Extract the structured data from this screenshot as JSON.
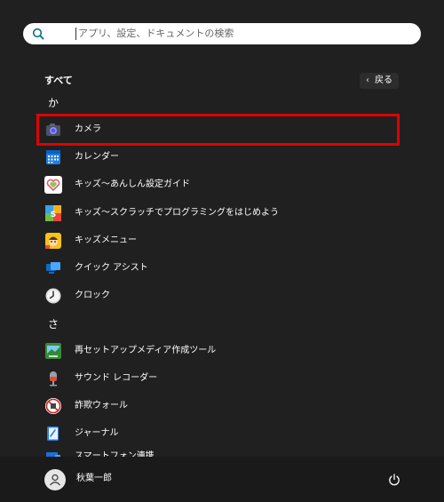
{
  "search": {
    "placeholder": "アプリ、設定、ドキュメントの検索"
  },
  "header": {
    "all_label": "すべて",
    "back_label": "戻る"
  },
  "sections": [
    {
      "letter": "か"
    },
    {
      "letter": "さ"
    }
  ],
  "apps": [
    {
      "label": "カメラ",
      "icon": "camera-icon"
    },
    {
      "label": "カレンダー",
      "icon": "calendar-icon"
    },
    {
      "label": "キッズ〜あんしん設定ガイド",
      "icon": "heart-icon"
    },
    {
      "label": "キッズ〜スクラッチでプログラミングをはじめよう",
      "icon": "scratch-icon"
    },
    {
      "label": "キッズメニュー",
      "icon": "kids-menu-icon"
    },
    {
      "label": "クイック アシスト",
      "icon": "quick-assist-icon"
    },
    {
      "label": "クロック",
      "icon": "clock-icon"
    },
    {
      "label": "再セットアップメディア作成ツール",
      "icon": "media-tool-icon"
    },
    {
      "label": "サウンド レコーダー",
      "icon": "microphone-icon"
    },
    {
      "label": "詐欺ウォール",
      "icon": "fraud-wall-icon"
    },
    {
      "label": "ジャーナル",
      "icon": "journal-icon"
    },
    {
      "label": "スマートフォン連携",
      "icon": "phone-link-icon"
    }
  ],
  "user": {
    "name": "秋葉一郎"
  },
  "colors": {
    "highlight": "#e00000",
    "background": "#202020"
  }
}
